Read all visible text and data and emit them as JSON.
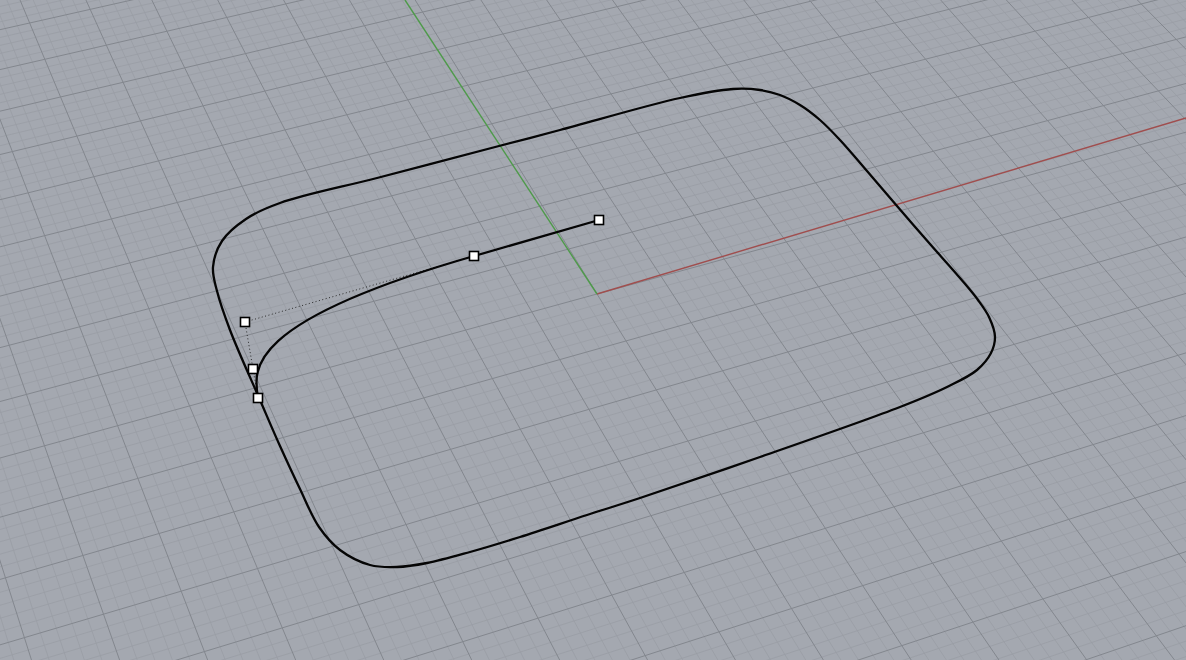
{
  "viewport": {
    "grid": true,
    "axes": [
      {
        "kind": "x",
        "color": "#a04e4e"
      },
      {
        "kind": "y",
        "color": "#4e9a4a"
      }
    ],
    "curves": [
      {
        "kind": "closed",
        "control_points_visible": false
      },
      {
        "kind": "open",
        "control_points_visible": true
      }
    ]
  }
}
